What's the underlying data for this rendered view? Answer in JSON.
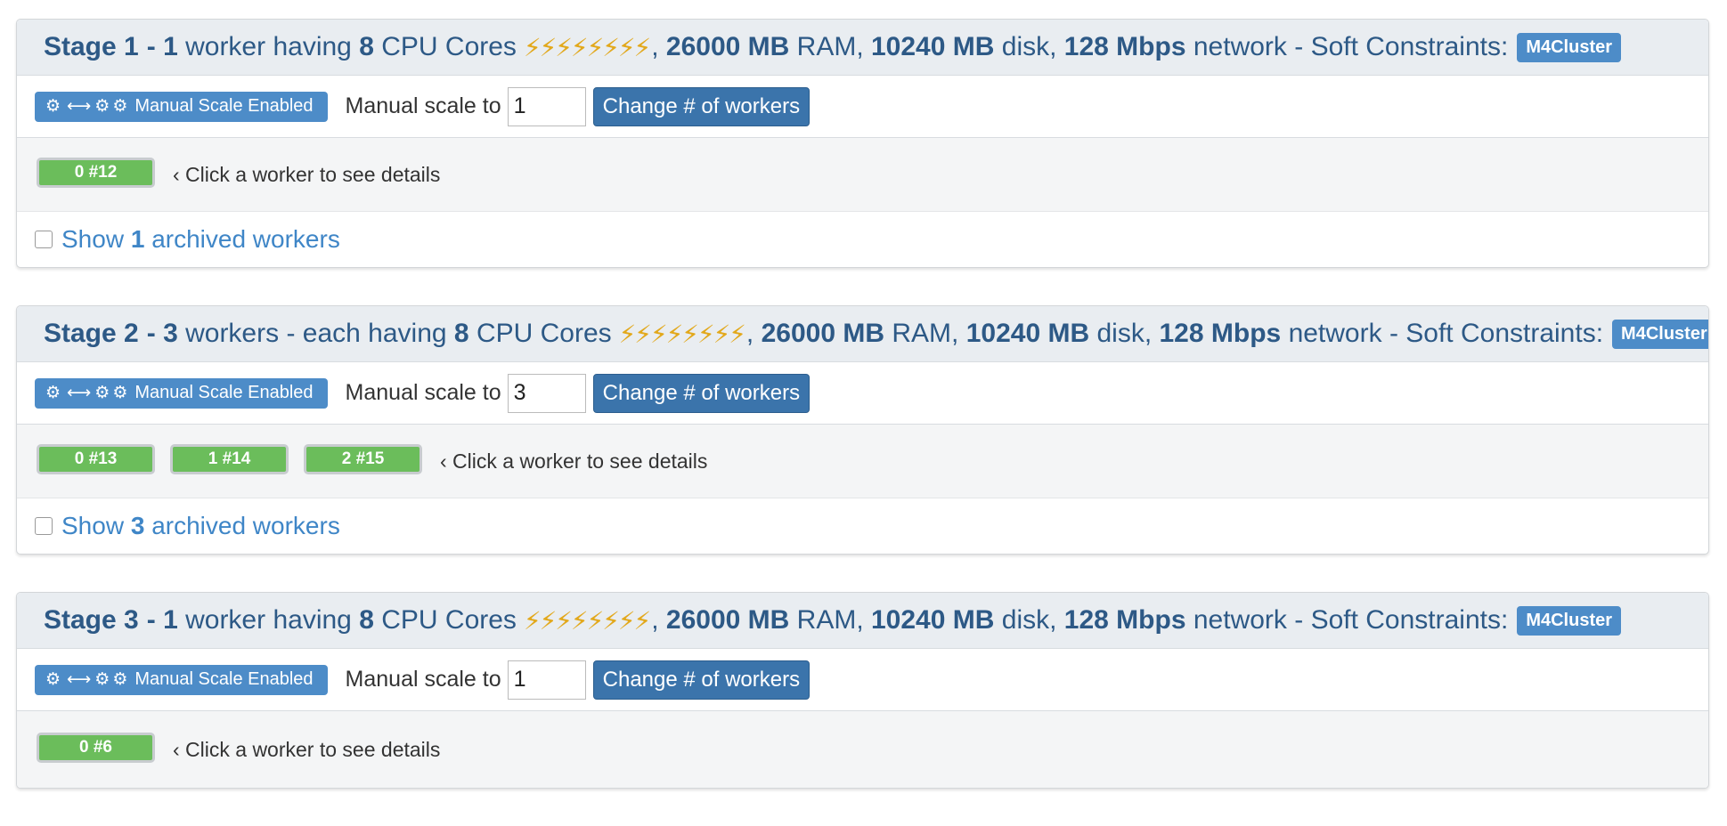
{
  "common": {
    "dash": "-",
    "cpu_cores_label": "CPU Cores",
    "bolts": "⚡⚡⚡⚡⚡⚡⚡⚡",
    "ram_value": "26000 MB",
    "ram_label": "RAM,",
    "disk_value": "10240 MB",
    "disk_label": "disk,",
    "net_value": "128 Mbps",
    "net_label": "network - Soft Constraints:",
    "constraint_tag": "M4Cluster",
    "scale_badge_label": "Manual Scale Enabled",
    "manual_scale_label": "Manual scale to",
    "change_button": "Change # of workers",
    "click_hint": "‹ Click a worker to see details",
    "show_label": "Show",
    "archived_label": "archived workers"
  },
  "stages": [
    {
      "title": "Stage 1",
      "count": "1",
      "worker_text": "worker having",
      "cores": "8",
      "scale_value": "1",
      "workers": [
        "0 #12"
      ],
      "archived_count": "1"
    },
    {
      "title": "Stage 2",
      "count": "3",
      "worker_text": "workers - each having",
      "cores": "8",
      "scale_value": "3",
      "workers": [
        "0 #13",
        "1 #14",
        "2 #15"
      ],
      "archived_count": "3"
    },
    {
      "title": "Stage 3",
      "count": "1",
      "worker_text": "worker having",
      "cores": "8",
      "scale_value": "1",
      "workers": [
        "0 #6"
      ],
      "archived_count": ""
    }
  ],
  "colors": {
    "header_bg": "#e9edf1",
    "header_text": "#2d5986",
    "badge_blue": "#4d8cc8",
    "button_blue": "#3b74ab",
    "worker_green": "#6bbd5b",
    "link_blue": "#3f86c7"
  },
  "icons": {
    "gear": "gear-icon",
    "scale_arrow": "left-right-arrow-icon",
    "bolt": "lightning-bolt-icon"
  }
}
